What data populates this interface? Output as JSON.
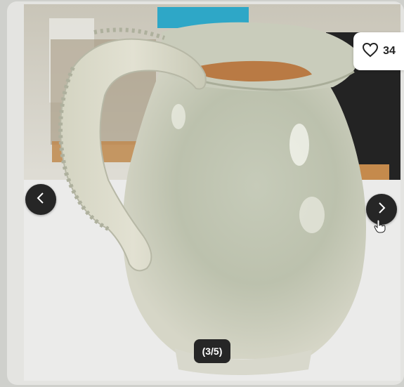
{
  "favorites": {
    "count": "34",
    "icon": "heart-outline-icon"
  },
  "gallery": {
    "counter": "(3/5)",
    "prev_icon": "chevron-left-icon",
    "next_icon": "chevron-right-icon",
    "current_index": 3,
    "total": 5
  },
  "cursor": {
    "icon": "hand-pointer-icon"
  },
  "colors": {
    "arrow_bg": "#262626",
    "jug_glaze": "#c4c8b6",
    "interior_clay": "#b97a44"
  }
}
